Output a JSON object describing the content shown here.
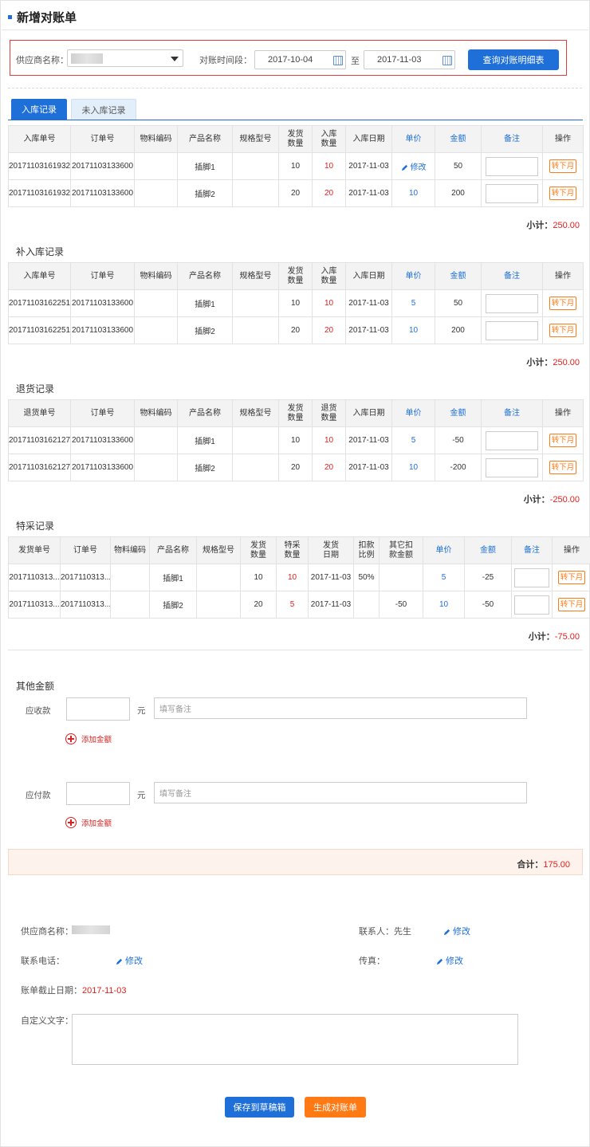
{
  "page_title": "新增对账单",
  "filter": {
    "supplier_label": "供应商名称：",
    "period_label": "对账时间段：",
    "start_date": "2017-10-04",
    "to_label": "至",
    "end_date": "2017-11-03",
    "query_button": "查询对账明细表"
  },
  "tabs": [
    {
      "label": "入库记录",
      "active": true
    },
    {
      "label": "未入库记录",
      "active": false
    }
  ],
  "common": {
    "edit_label": "修改",
    "transfer_label": "转下月",
    "subtotal_label": "小计：",
    "total_label": "合计："
  },
  "inbound": {
    "headers": [
      "入库单号",
      "订单号",
      "物料编码",
      "产品名称",
      "规格型号",
      "发货\n数量",
      "入库\n数量",
      "入库日期",
      "单价",
      "金额",
      "备注",
      "操作"
    ],
    "rows": [
      {
        "no": "20171103161932",
        "order": "20171103133600",
        "code": "",
        "product": "插脚1",
        "spec": "",
        "ship": "10",
        "qty": "10",
        "date": "2017-11-03",
        "price": "",
        "amount": "50"
      },
      {
        "no": "20171103161932",
        "order": "20171103133600",
        "code": "",
        "product": "插脚2",
        "spec": "",
        "ship": "20",
        "qty": "20",
        "date": "2017-11-03",
        "price": "10",
        "amount": "200"
      }
    ],
    "subtotal": "250.00"
  },
  "supplement": {
    "title": "补入库记录",
    "headers": [
      "入库单号",
      "订单号",
      "物料编码",
      "产品名称",
      "规格型号",
      "发货\n数量",
      "入库\n数量",
      "入库日期",
      "单价",
      "金额",
      "备注",
      "操作"
    ],
    "rows": [
      {
        "no": "20171103162251",
        "order": "20171103133600",
        "code": "",
        "product": "插脚1",
        "spec": "",
        "ship": "10",
        "qty": "10",
        "date": "2017-11-03",
        "price": "5",
        "amount": "50"
      },
      {
        "no": "20171103162251",
        "order": "20171103133600",
        "code": "",
        "product": "插脚2",
        "spec": "",
        "ship": "20",
        "qty": "20",
        "date": "2017-11-03",
        "price": "10",
        "amount": "200"
      }
    ],
    "subtotal": "250.00"
  },
  "returns": {
    "title": "退货记录",
    "headers": [
      "退货单号",
      "订单号",
      "物料编码",
      "产品名称",
      "规格型号",
      "发货\n数量",
      "退货\n数量",
      "入库日期",
      "单价",
      "金额",
      "备注",
      "操作"
    ],
    "rows": [
      {
        "no": "20171103162127",
        "order": "20171103133600",
        "code": "",
        "product": "插脚1",
        "spec": "",
        "ship": "10",
        "qty": "10",
        "date": "2017-11-03",
        "price": "5",
        "amount": "-50"
      },
      {
        "no": "20171103162127",
        "order": "20171103133600",
        "code": "",
        "product": "插脚2",
        "spec": "",
        "ship": "20",
        "qty": "20",
        "date": "2017-11-03",
        "price": "10",
        "amount": "-200"
      }
    ],
    "subtotal": "-250.00"
  },
  "special": {
    "title": "特采记录",
    "headers": [
      "发货单号",
      "订单号",
      "物料编码",
      "产品名称",
      "规格型号",
      "发货\n数量",
      "特采\n数量",
      "发货\n日期",
      "扣款\n比例",
      "其它扣\n款金额",
      "单价",
      "金额",
      "备注",
      "操作"
    ],
    "rows": [
      {
        "no": "2017110313...",
        "order": "2017110313...",
        "code": "",
        "product": "插脚1",
        "spec": "",
        "ship": "10",
        "qty": "10",
        "date": "2017-11-03",
        "ratio": "50%",
        "other": "",
        "price": "5",
        "amount": "-25"
      },
      {
        "no": "2017110313...",
        "order": "2017110313...",
        "code": "",
        "product": "插脚2",
        "spec": "",
        "ship": "20",
        "qty": "5",
        "date": "2017-11-03",
        "ratio": "",
        "other": "-50",
        "price": "10",
        "amount": "-50"
      }
    ],
    "subtotal": "-75.00"
  },
  "other": {
    "title": "其他金额",
    "receivable_label": "应收款",
    "payable_label": "应付款",
    "unit": "元",
    "remark_placeholder": "填写备注",
    "add_label": "添加金额",
    "total": "175.00"
  },
  "info": {
    "supplier_label": "供应商名称：",
    "contact_label": "联系人：先生",
    "phone_label": "联系电话：",
    "fax_label": "传真：",
    "deadline_label": "账单截止日期：",
    "deadline_value": "2017-11-03",
    "custom_text_label": "自定义文字："
  },
  "buttons": {
    "save_draft": "保存到草稿箱",
    "generate": "生成对账单"
  },
  "colors": {
    "primary": "#1e6fd8",
    "accent": "#ff7a14",
    "negative": "#e02020"
  }
}
